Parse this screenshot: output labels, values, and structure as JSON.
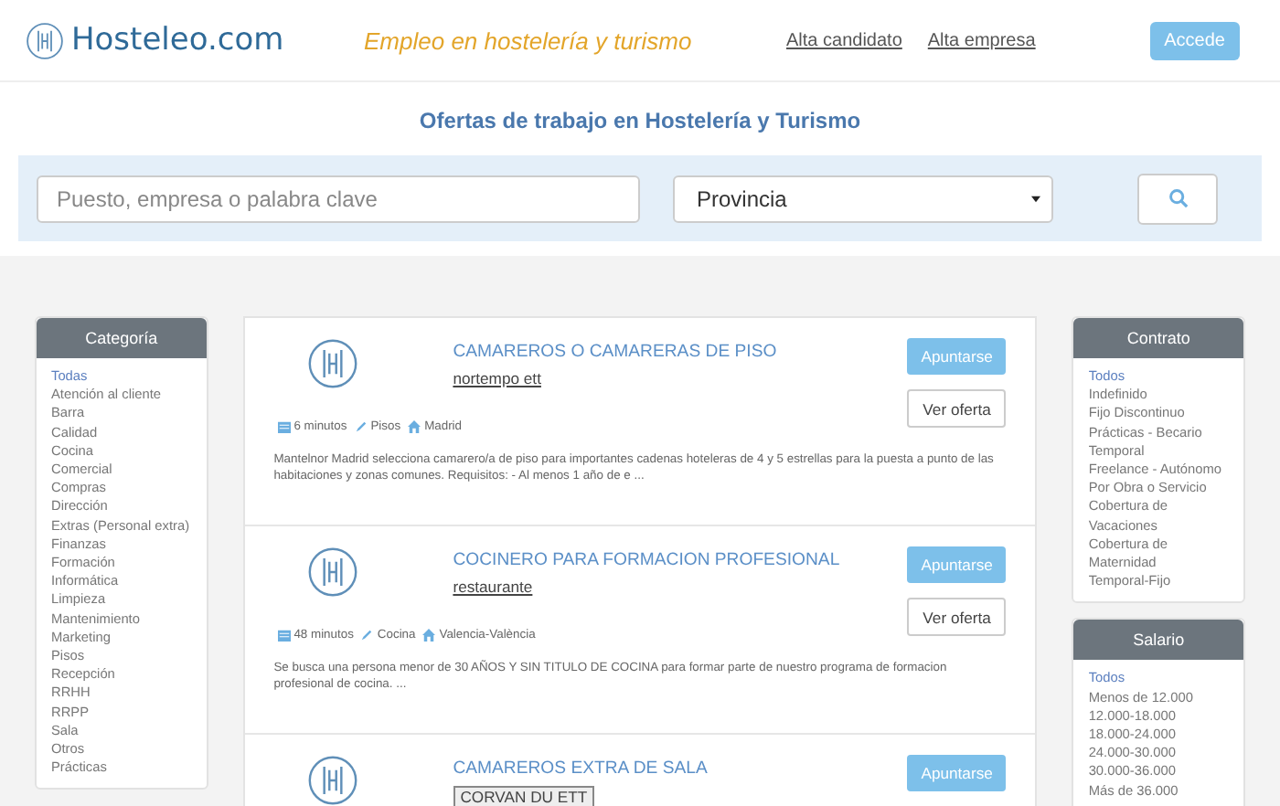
{
  "header": {
    "logo": "Hosteleo.com",
    "tagline": "Empleo en hostelería y turismo",
    "links": [
      "Alta candidato",
      "Alta empresa"
    ],
    "login_button": "Accede"
  },
  "hero": {
    "title": "Ofertas de trabajo en Hostelería y Turismo",
    "search": {
      "placeholder": "Puesto, empresa o palabra clave"
    },
    "province": {
      "value": "Provincia"
    }
  },
  "category_filter": {
    "title": "Categoría",
    "items": [
      {
        "label": "Todas",
        "selected": true
      },
      {
        "label": "Atención al cliente",
        "selected": false
      },
      {
        "label": "Barra",
        "selected": false
      },
      {
        "label": "Calidad",
        "selected": false
      },
      {
        "label": "Cocina",
        "selected": false
      },
      {
        "label": "Comercial",
        "selected": false
      },
      {
        "label": "Compras",
        "selected": false
      },
      {
        "label": "Dirección",
        "selected": false
      },
      {
        "label": "Extras (Personal extra)",
        "selected": false
      },
      {
        "label": "Finanzas",
        "selected": false
      },
      {
        "label": "Formación",
        "selected": false
      },
      {
        "label": "Informática",
        "selected": false
      },
      {
        "label": "Limpieza",
        "selected": false
      },
      {
        "label": "Mantenimiento",
        "selected": false
      },
      {
        "label": "Marketing",
        "selected": false
      },
      {
        "label": "Pisos",
        "selected": false
      },
      {
        "label": "Recepción",
        "selected": false
      },
      {
        "label": "RRHH",
        "selected": false
      },
      {
        "label": "RRPP",
        "selected": false
      },
      {
        "label": "Sala",
        "selected": false
      },
      {
        "label": "Otros",
        "selected": false
      },
      {
        "label": "Prácticas",
        "selected": false
      }
    ]
  },
  "jobs": [
    {
      "title": "CAMAREROS O CAMARERAS DE PISO",
      "company": "nortempo ett",
      "company_boxed": false,
      "apply_button": "Apuntarse",
      "view_button": "Ver oferta",
      "posted": "6 minutos",
      "category": "Pisos",
      "location": "Madrid",
      "description": "Mantelnor Madrid selecciona camarero/a de piso para importantes cadenas hoteleras de 4 y 5 estrellas para la puesta a punto de las habitaciones y zonas comunes. Requisitos: - Al menos 1 año de e ..."
    },
    {
      "title": "COCINERO PARA FORMACION PROFESIONAL",
      "company": "restaurante",
      "company_boxed": false,
      "apply_button": "Apuntarse",
      "view_button": "Ver oferta",
      "posted": "48 minutos",
      "category": "Cocina",
      "location": "Valencia-València",
      "description": "Se busca una persona menor de 30 AÑOS Y SIN TITULO DE COCINA para formar parte de nuestro programa de formacion profesional de cocina. ..."
    },
    {
      "title": "CAMAREROS EXTRA DE SALA",
      "company": "CORVAN DU ETT",
      "company_boxed": true,
      "apply_button": "Apuntarse"
    }
  ],
  "contract_filter": {
    "title": "Contrato",
    "items": [
      {
        "label": "Todos",
        "selected": true
      },
      {
        "label": "Indefinido",
        "selected": false
      },
      {
        "label": "Fijo Discontinuo",
        "selected": false
      },
      {
        "label": "Prácticas - Becario",
        "selected": false
      },
      {
        "label": "Temporal",
        "selected": false
      },
      {
        "label": "Freelance - Autónomo",
        "selected": false
      },
      {
        "label": "Por Obra o Servicio",
        "selected": false
      },
      {
        "label": "Cobertura de Vacaciones",
        "selected": false
      },
      {
        "label": "Cobertura de Maternidad",
        "selected": false
      },
      {
        "label": "Temporal-Fijo",
        "selected": false
      }
    ]
  },
  "salary_filter": {
    "title": "Salario",
    "items": [
      {
        "label": "Todos",
        "selected": true
      },
      {
        "label": "Menos de 12.000",
        "selected": false
      },
      {
        "label": "12.000-18.000",
        "selected": false
      },
      {
        "label": "18.000-24.000",
        "selected": false
      },
      {
        "label": "24.000-30.000",
        "selected": false
      },
      {
        "label": "30.000-36.000",
        "selected": false
      },
      {
        "label": "Más de 36.000",
        "selected": false
      }
    ]
  }
}
